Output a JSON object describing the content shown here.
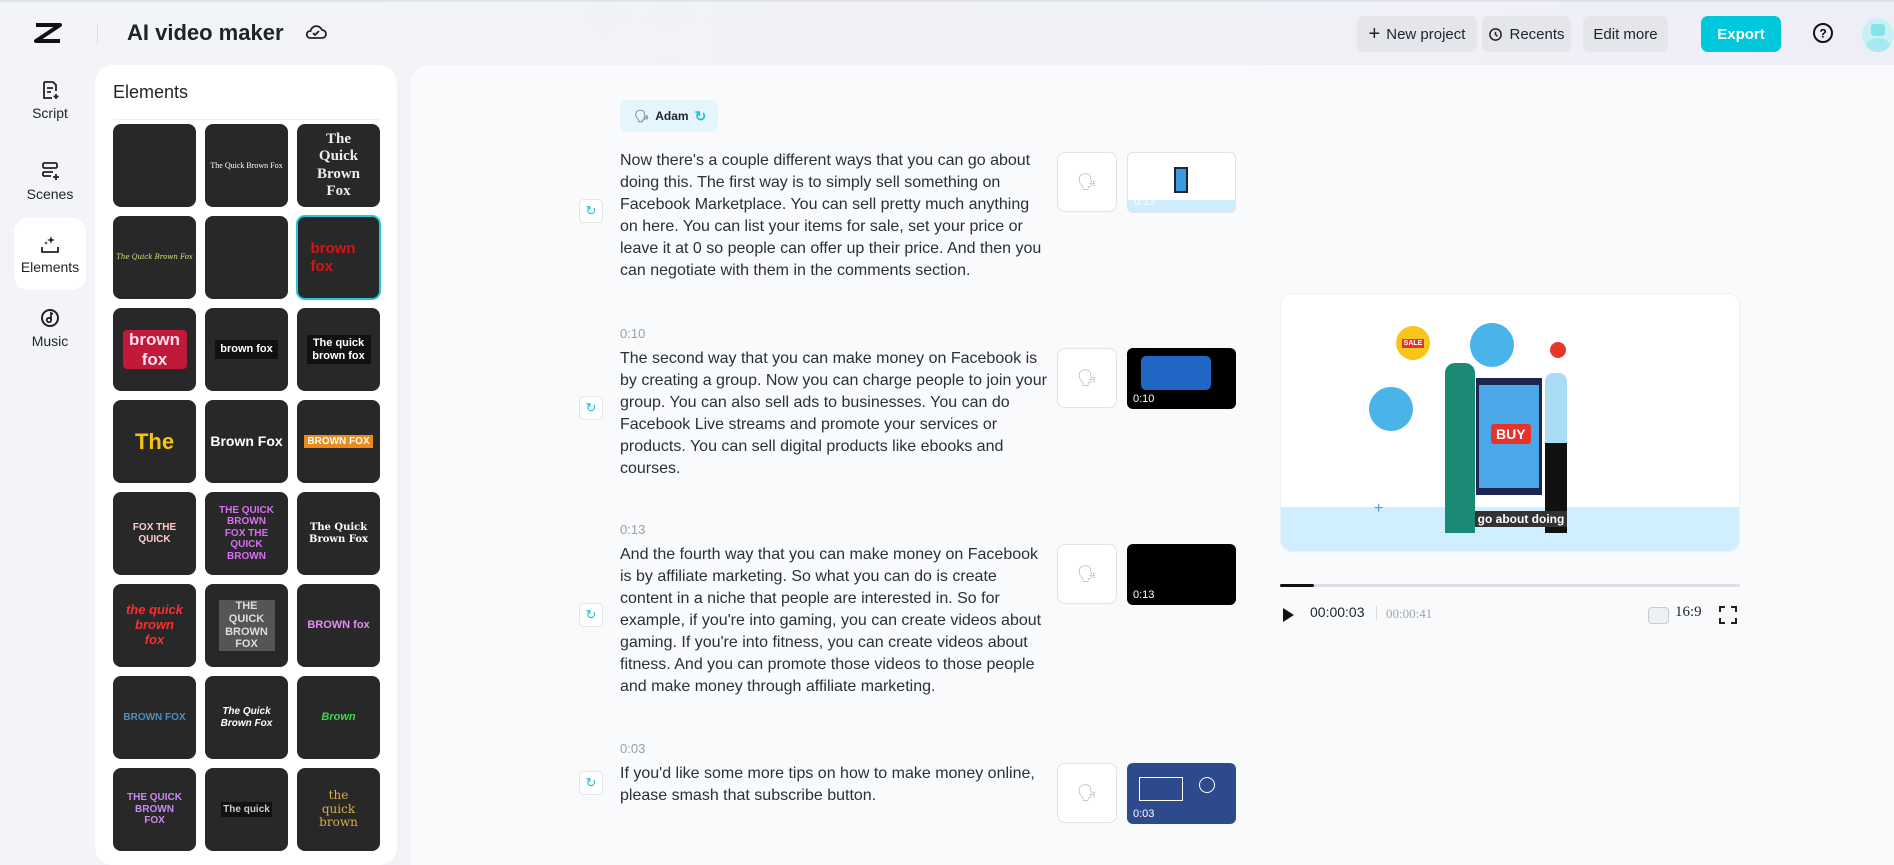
{
  "header": {
    "title": "AI video maker",
    "buttons": {
      "new_project": "New project",
      "recents": "Recents",
      "edit_more": "Edit more",
      "export": "Export"
    }
  },
  "rail": [
    {
      "label": "Script"
    },
    {
      "label": "Scenes"
    },
    {
      "label": "Elements"
    },
    {
      "label": "Music"
    }
  ],
  "elements_panel": {
    "title": "Elements",
    "tiles": [
      "",
      "The Quick Brown Fox",
      "The Quick Brown Fox",
      "The Quick Brown Fox",
      "",
      "brown fox",
      "brown fox",
      "brown fox",
      "The quick brown fox",
      "The",
      "Brown Fox",
      "BROWN FOX",
      "FOX THE QUICK",
      "THE QUICK BROWN FOX THE QUICK BROWN",
      "The Quick Brown Fox",
      "the quick brown fox",
      "THE QUICK BROWN FOX",
      "BROWN fox",
      "BROWN FOX",
      "The Quick Brown Fox",
      "Brown",
      "THE QUICK BROWN FOX",
      "The quick",
      "the quick brown"
    ]
  },
  "script": {
    "voice": "Adam",
    "scenes": [
      {
        "time": "",
        "text": "Now there's a couple different ways that you can go about doing this. The first way is to simply sell something on Facebook Marketplace. You can sell pretty much anything on here. You can list your items for sale, set your price or leave it at 0 so people can offer up their price. And then you can negotiate with them in the comments section.",
        "thumb_time": "0:13"
      },
      {
        "time": "0:10",
        "text": "The second way that you can make money on Facebook is by creating a group. Now you can charge people to join your group. You can also sell ads to businesses. You can do Facebook Live streams and promote your services or products. You can sell digital products like ebooks and courses.",
        "thumb_time": "0:10"
      },
      {
        "time": "0:13",
        "text": "And the fourth way that you can make money on Facebook is by affiliate marketing. So what you can do is create content in a niche that people are interested in. So for example, if you're into gaming, you can create videos about gaming. If you're into fitness, you can create videos about fitness. And you can promote those videos to those people and make money through affiliate marketing.",
        "thumb_time": "0:13"
      },
      {
        "time": "0:03",
        "text": "If you'd like some more tips on how to make money online, please smash that subscribe button.",
        "thumb_time": "0:03"
      }
    ]
  },
  "preview": {
    "caption": "go about doing",
    "buy": "BUY",
    "sale": "SALE",
    "current": "00:00:03",
    "total": "00:00:41",
    "progress_percent": 7.3,
    "aspect": "16:9"
  },
  "colors": {
    "accent": "#00c8dc"
  }
}
